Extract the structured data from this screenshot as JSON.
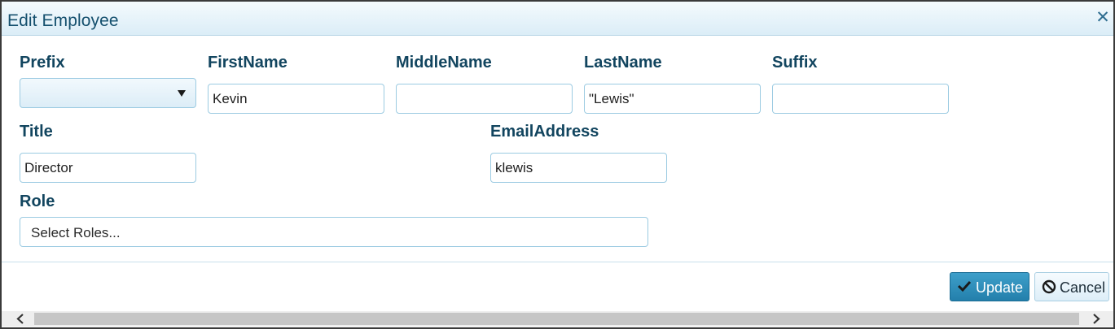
{
  "window": {
    "title": "Edit Employee",
    "close_icon": "close-icon"
  },
  "form": {
    "prefix": {
      "label": "Prefix",
      "value": ""
    },
    "first_name": {
      "label": "FirstName",
      "value": "Kevin"
    },
    "middle_name": {
      "label": "MiddleName",
      "value": ""
    },
    "last_name": {
      "label": "LastName",
      "value": "\"Lewis\""
    },
    "suffix": {
      "label": "Suffix",
      "value": ""
    },
    "title": {
      "label": "Title",
      "value": "Director"
    },
    "email": {
      "label": "EmailAddress",
      "value": "klewis"
    },
    "role": {
      "label": "Role",
      "placeholder": "Select Roles..."
    }
  },
  "actions": {
    "update_label": "Update",
    "update_icon": "check-icon",
    "cancel_label": "Cancel",
    "cancel_icon": "ban-icon"
  },
  "colors": {
    "accent": "#237fab",
    "label": "#12455f",
    "title": "#15506e",
    "border": "#9ccbe2"
  }
}
